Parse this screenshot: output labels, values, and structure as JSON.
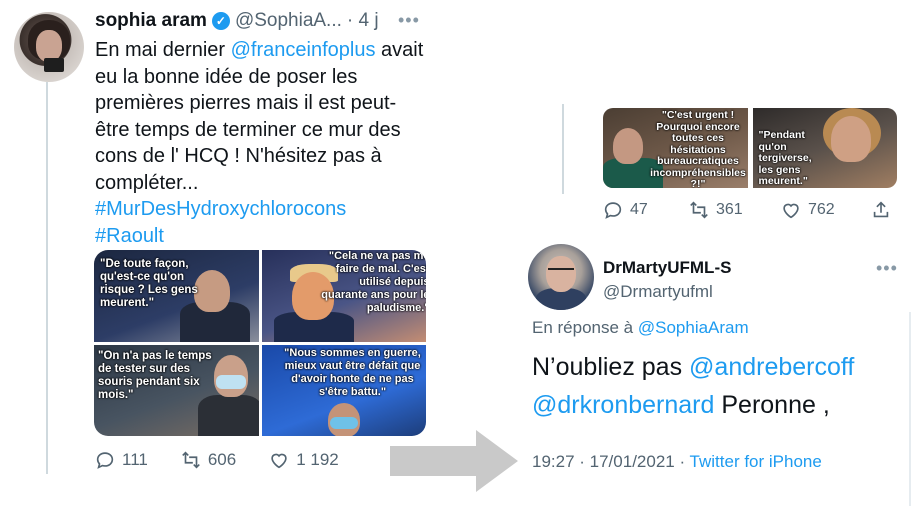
{
  "left_tweet": {
    "author_name": "sophia aram",
    "author_handle": "@SophiaA...",
    "time_ago": "· 4 j",
    "more": "•••",
    "text_before_mention": "En mai dernier ",
    "mention": "@franceinfoplus",
    "text_after_mention": " avait eu la bonne idée de poser les premières pierres mais il est peut-être temps de terminer ce mur des cons de l' HCQ ! N'hésitez pas à compléter...",
    "hashtags": [
      "#MurDesHydroxychlorocons",
      "#Raoult"
    ],
    "images": [
      {
        "quote": "\"De toute façon, qu'est-ce qu'on risque ? Les gens meurent.\""
      },
      {
        "quote": "\"Cela ne va pas me faire de mal. C'est utilisé depuis quarante ans pour le paludisme.\""
      },
      {
        "quote": "\"On n'a pas le temps de tester sur des souris pendant six mois.\""
      },
      {
        "quote": "\"Nous sommes en guerre, mieux vaut être défait que d'avoir honte de ne pas s'être battu.\""
      }
    ],
    "actions": {
      "replies": "111",
      "retweets": "606",
      "likes": "1 192"
    }
  },
  "right_top_fragment": {
    "images": [
      {
        "quote": "\"C'est urgent ! Pourquoi encore toutes ces hésitations bureaucratiques incompréhensibles ?!\""
      },
      {
        "quote": "\"Pendant qu'on tergiverse, les gens meurent.\""
      }
    ],
    "actions": {
      "replies": "47",
      "retweets": "361",
      "likes": "762"
    }
  },
  "reply_tweet": {
    "author_name": "DrMartyUFML-S",
    "author_handle": "@Drmartyufml",
    "more": "•••",
    "replying_prefix": "En réponse à ",
    "replying_to": "@SophiaAram",
    "body_prefix": "N’oubliez pas ",
    "mention_1": "@andrebercoff",
    "mention_2": "@drkronbernard",
    "body_suffix": " Peronne ,",
    "timestamp": "19:27 · 17/01/2021 · ",
    "client": "Twitter for iPhone"
  },
  "colors": {
    "link": "#1d9bf0",
    "muted": "#536471",
    "text": "#0f1419"
  },
  "icons": [
    "verified-badge-icon",
    "reply-icon",
    "retweet-icon",
    "like-icon",
    "share-icon",
    "arrow-right-icon"
  ]
}
